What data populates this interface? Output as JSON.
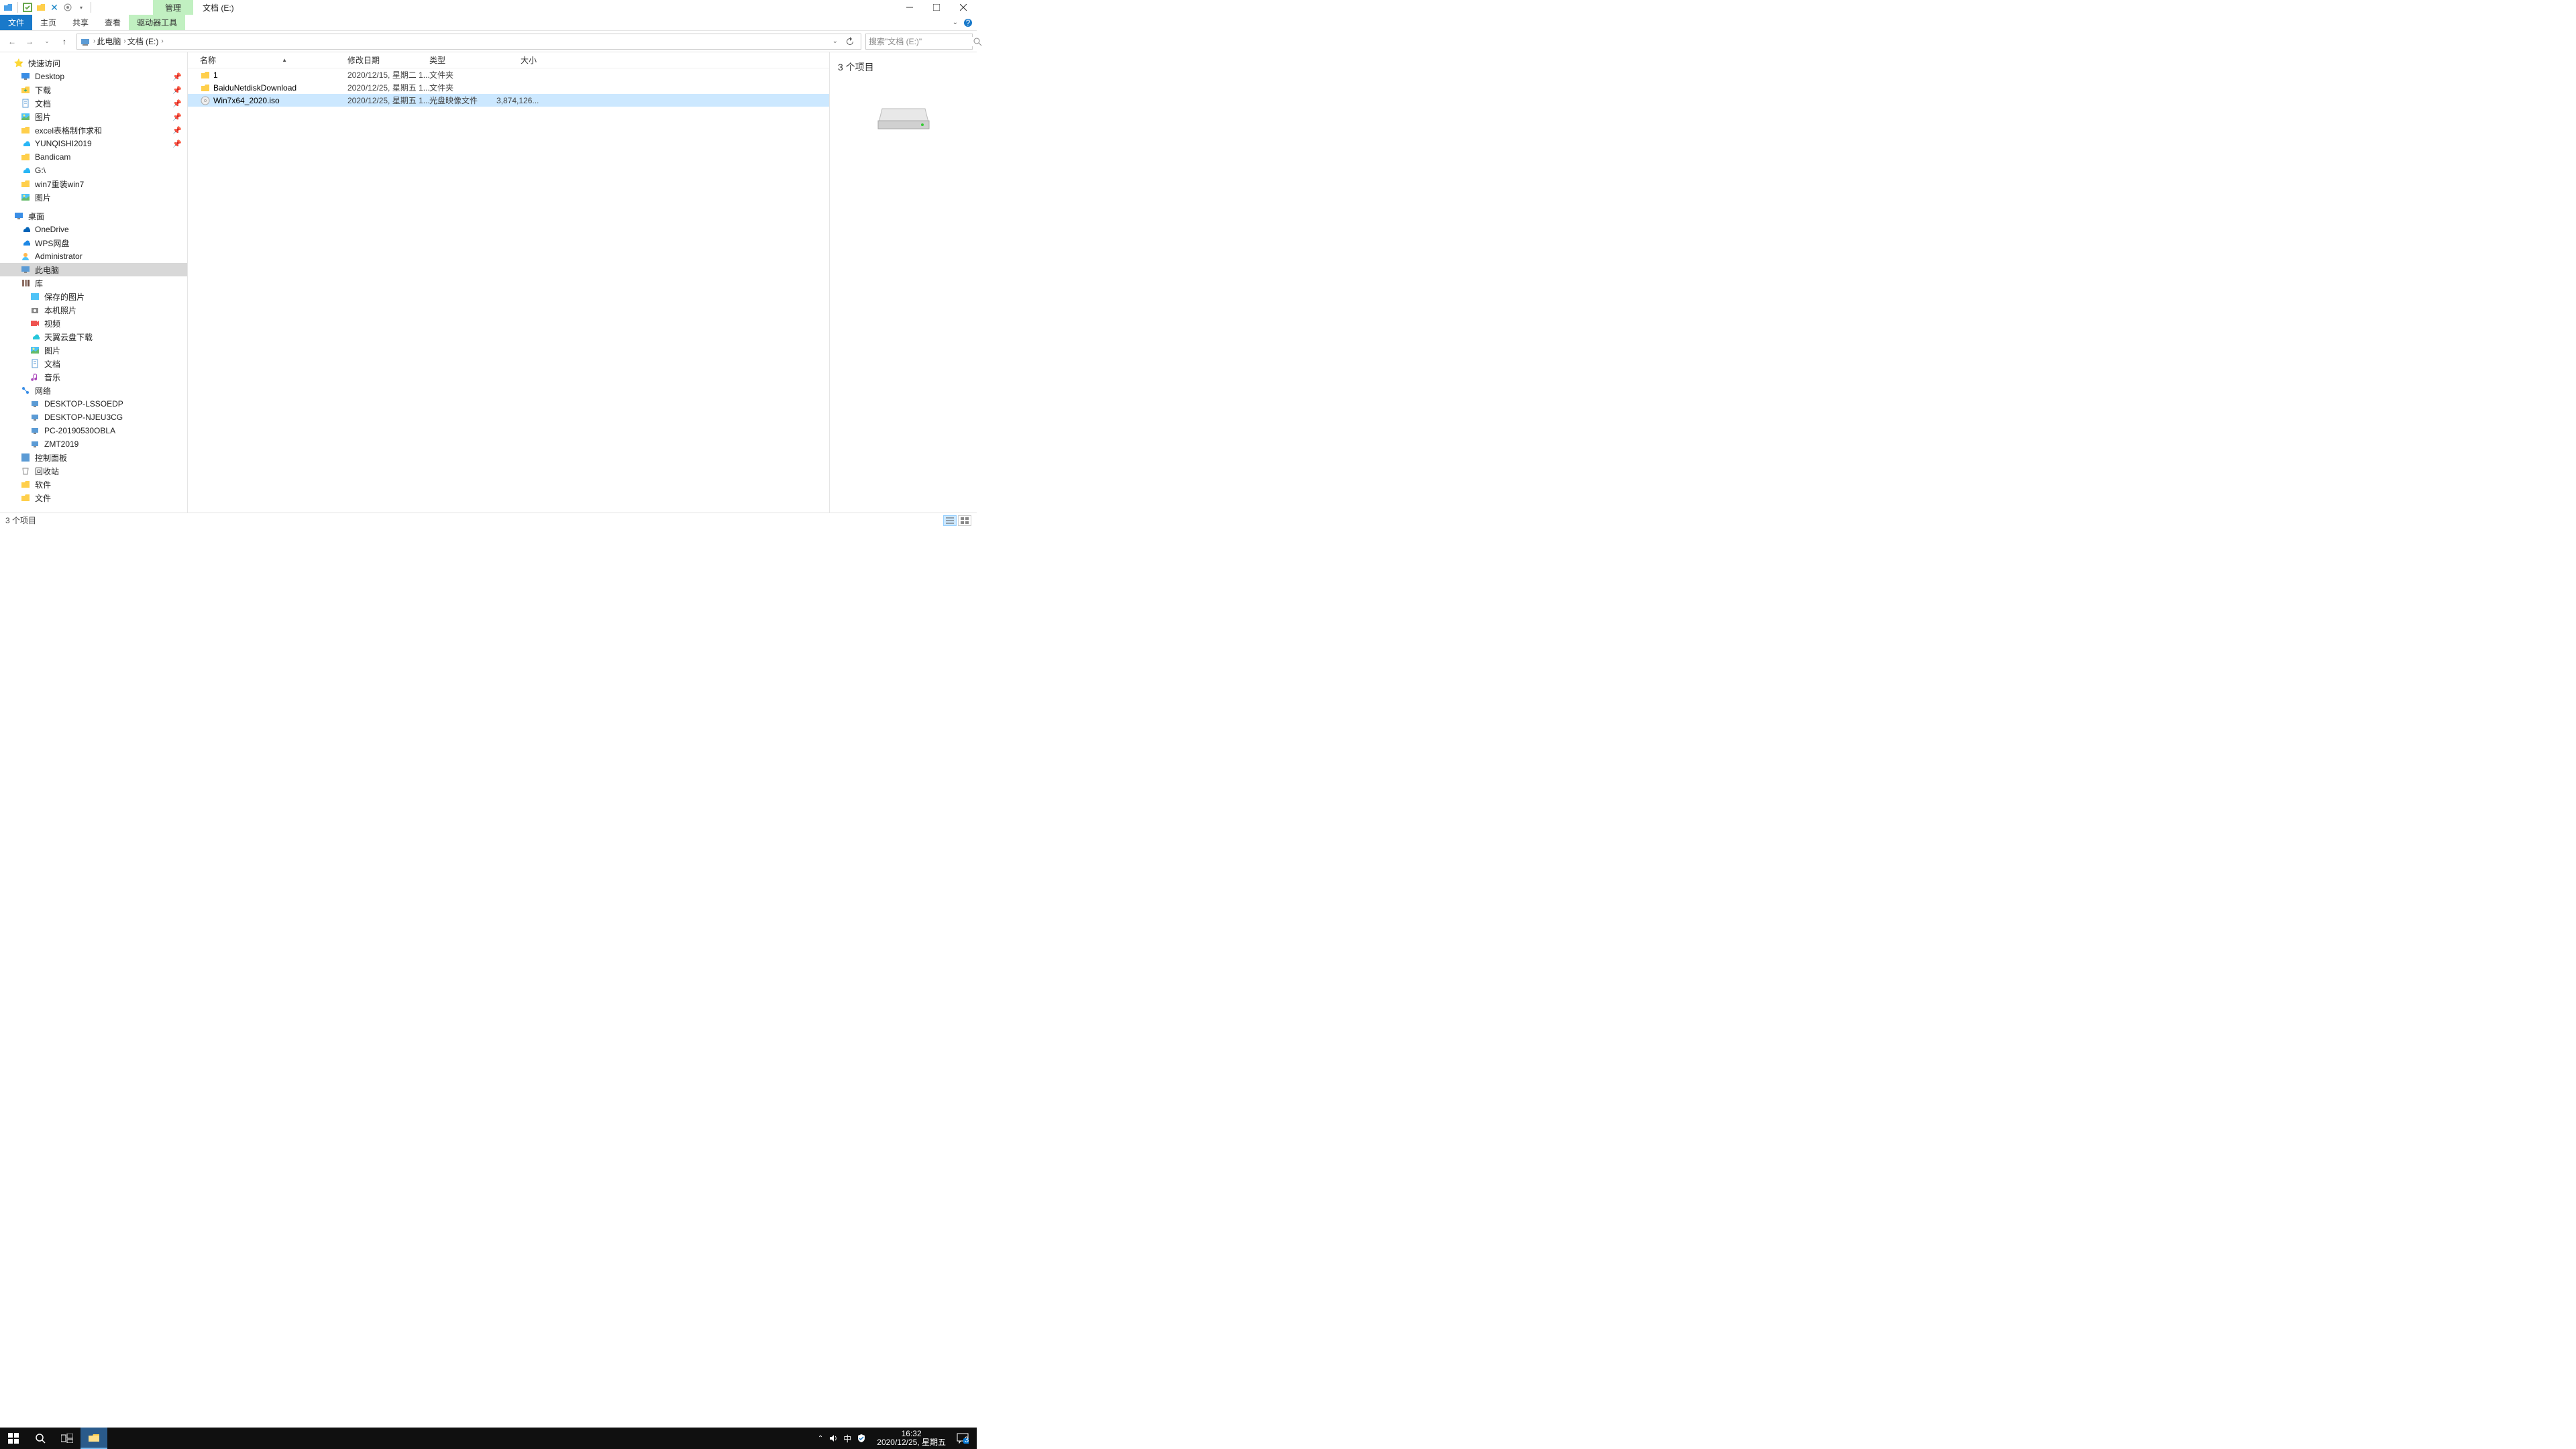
{
  "titlebar": {
    "contextual_tab": "管理",
    "title": "文档 (E:)"
  },
  "menubar": {
    "file": "文件",
    "home": "主页",
    "share": "共享",
    "view": "查看",
    "drive_tools": "驱动器工具"
  },
  "address": {
    "segments": [
      "此电脑",
      "文档 (E:)"
    ]
  },
  "search": {
    "placeholder": "搜索\"文档 (E:)\""
  },
  "tree": {
    "quick_access": "快速访问",
    "quick": [
      {
        "label": "Desktop",
        "icon": "desktop",
        "pin": true
      },
      {
        "label": "下载",
        "icon": "download",
        "pin": true
      },
      {
        "label": "文档",
        "icon": "doc",
        "pin": true
      },
      {
        "label": "图片",
        "icon": "pic",
        "pin": true
      },
      {
        "label": "excel表格制作求和",
        "icon": "folder",
        "pin": true
      },
      {
        "label": "YUNQISHI2019",
        "icon": "cloud",
        "pin": true
      },
      {
        "label": "Bandicam",
        "icon": "folder"
      },
      {
        "label": "G:\\",
        "icon": "cloud"
      },
      {
        "label": "win7重装win7",
        "icon": "folder"
      },
      {
        "label": "图片",
        "icon": "pic"
      }
    ],
    "desktop_root": "桌面",
    "desktop": [
      {
        "label": "OneDrive",
        "icon": "onedrive"
      },
      {
        "label": "WPS网盘",
        "icon": "wps"
      },
      {
        "label": "Administrator",
        "icon": "user"
      },
      {
        "label": "此电脑",
        "icon": "pc",
        "selected": true
      },
      {
        "label": "库",
        "icon": "lib"
      }
    ],
    "libs": [
      {
        "label": "保存的图片",
        "icon": "savedpic"
      },
      {
        "label": "本机照片",
        "icon": "camera"
      },
      {
        "label": "视频",
        "icon": "video"
      },
      {
        "label": "天翼云盘下载",
        "icon": "cloud2"
      },
      {
        "label": "图片",
        "icon": "pic"
      },
      {
        "label": "文档",
        "icon": "doc"
      },
      {
        "label": "音乐",
        "icon": "music"
      }
    ],
    "network": "网络",
    "net": [
      {
        "label": "DESKTOP-LSSOEDP"
      },
      {
        "label": "DESKTOP-NJEU3CG"
      },
      {
        "label": "PC-20190530OBLA"
      },
      {
        "label": "ZMT2019"
      }
    ],
    "panel": "控制面板",
    "recycle": "回收站",
    "soft": "软件",
    "files": "文件"
  },
  "columns": {
    "name": "名称",
    "date": "修改日期",
    "type": "类型",
    "size": "大小"
  },
  "rows": [
    {
      "name": "1",
      "date": "2020/12/15, 星期二 1...",
      "type": "文件夹",
      "size": "",
      "icon": "folder"
    },
    {
      "name": "BaiduNetdiskDownload",
      "date": "2020/12/25, 星期五 1...",
      "type": "文件夹",
      "size": "",
      "icon": "folder"
    },
    {
      "name": "Win7x64_2020.iso",
      "date": "2020/12/25, 星期五 1...",
      "type": "光盘映像文件",
      "size": "3,874,126...",
      "icon": "iso",
      "selected": true
    }
  ],
  "details": {
    "count": "3 个项目"
  },
  "status": {
    "text": "3 个项目"
  },
  "taskbar": {
    "time": "16:32",
    "date": "2020/12/25, 星期五",
    "ime": "中",
    "notif_count": "3"
  }
}
